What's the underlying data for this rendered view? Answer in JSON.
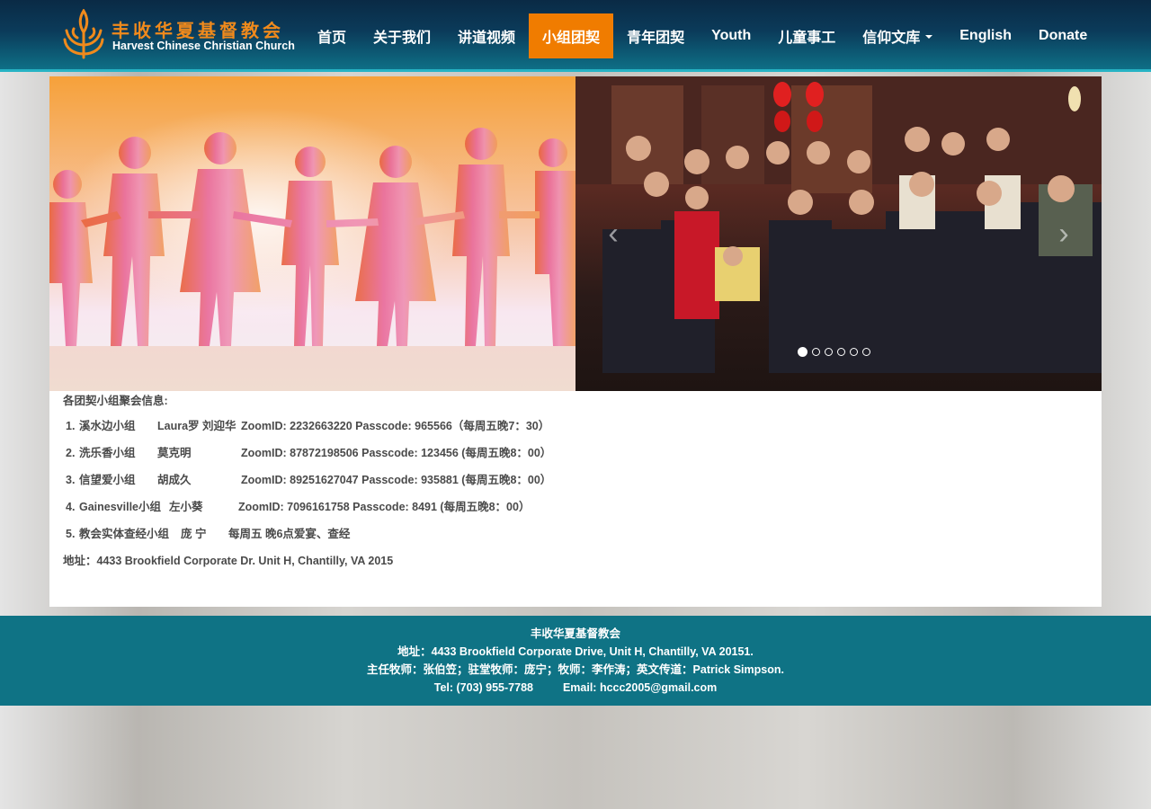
{
  "brand": {
    "name_cn": "丰收华夏基督教会",
    "name_en": "Harvest Chinese Christian Church",
    "accent_color": "#f07c00",
    "logo_icon": "wheat-logo-icon"
  },
  "nav": {
    "items": [
      {
        "label": "首页",
        "active": false
      },
      {
        "label": "关于我们",
        "active": false
      },
      {
        "label": "讲道视频",
        "active": false
      },
      {
        "label": "小组团契",
        "active": true
      },
      {
        "label": "青年团契",
        "active": false
      },
      {
        "label": "Youth",
        "active": false
      },
      {
        "label": "儿童事工",
        "active": false
      },
      {
        "label": "信仰文库",
        "active": false,
        "dropdown": true
      },
      {
        "label": "English",
        "active": false
      },
      {
        "label": "Donate",
        "active": false
      }
    ]
  },
  "carousel": {
    "prev_icon": "chevron-left-icon",
    "next_icon": "chevron-right-icon",
    "prev_glyph": "‹",
    "next_glyph": "›",
    "slide_count": 6,
    "active_index": 0
  },
  "groups": {
    "title": "各团契小组聚会信息:",
    "rows": [
      {
        "num": "1.",
        "name": "溪水边小组",
        "leader": "Laura罗 刘迎华",
        "info": "ZoomID: 2232663220 Passcode: 965566（每周五晚7：30）"
      },
      {
        "num": "2.",
        "name": "洗乐香小组",
        "leader": "莫克明",
        "info": "ZoomID: 87872198506 Passcode: 123456 (每周五晚8：00）"
      },
      {
        "num": "3.",
        "name": "信望爱小组",
        "leader": "胡成久",
        "info": "ZoomID: 89251627047 Passcode: 935881 (每周五晚8：00）"
      },
      {
        "num": "4.",
        "name": "Gainesville小组",
        "leader": "左小葵",
        "info": "ZoomID: 7096161758 Passcode: 8491 (每周五晚8：00）"
      },
      {
        "num": "5.",
        "name": "教会实体查经小组",
        "leader": "庞  宁",
        "info": "每周五 晚6点爱宴、查经"
      }
    ],
    "address": "地址：4433 Brookfield Corporate Dr. Unit H, Chantilly, VA 2015"
  },
  "footer": {
    "name": "丰收华夏基督教会",
    "address": "地址：4433 Brookfield Corporate Drive, Unit H, Chantilly, VA 20151.",
    "staff": "主任牧师：张伯笠；驻堂牧师：庞宁；牧师：李作涛；英文传道：Patrick Simpson.",
    "tel": "Tel: (703) 955-7788",
    "email": "Email: hccc2005@gmail.com"
  }
}
